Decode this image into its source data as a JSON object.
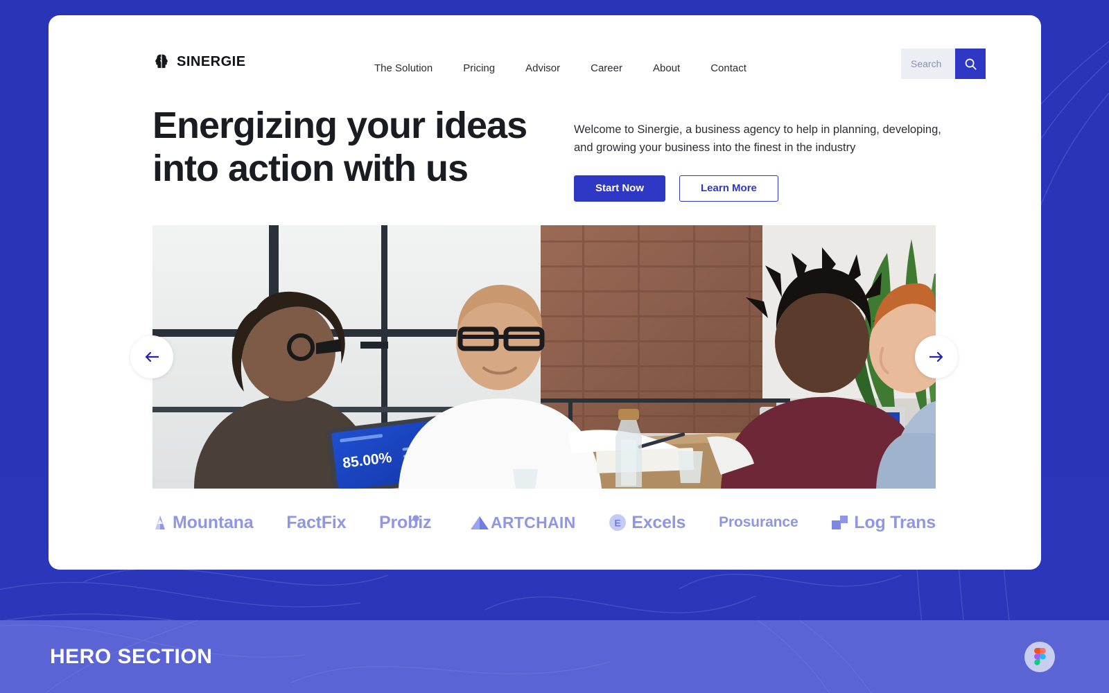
{
  "brand": {
    "name": "SINERGIE",
    "icon": "two-heads-icon",
    "color": "#111218"
  },
  "nav": {
    "items": [
      {
        "label": "The Solution"
      },
      {
        "label": "Pricing"
      },
      {
        "label": "Advisor"
      },
      {
        "label": "Career"
      },
      {
        "label": "About"
      },
      {
        "label": "Contact"
      }
    ]
  },
  "search": {
    "placeholder": "Search",
    "value": "",
    "icon": "search-icon",
    "button_color": "#2e38c4"
  },
  "hero": {
    "title": "Energizing your ideas into action with us",
    "description": "Welcome to Sinergie, a business agency to help in planning, developing, and growing your business into the finest in the industry",
    "primary_button": "Start Now",
    "secondary_button": "Learn More"
  },
  "carousel": {
    "prev_icon": "arrow-left-icon",
    "next_icon": "arrow-right-icon",
    "image_alt": "business meeting photo",
    "screen_value": "85.00%"
  },
  "partners": [
    {
      "name": "Mountana",
      "icon": "mountain-icon"
    },
    {
      "name": "FactFix",
      "icon": "none"
    },
    {
      "name": "Probiz",
      "icon": "dot-icon"
    },
    {
      "name": "ARTCHAIN",
      "icon": "triangle-icon"
    },
    {
      "name": "Excels",
      "icon": "circle-e-icon"
    },
    {
      "name": "Prosurance",
      "icon": "none"
    },
    {
      "name": "Log Trans",
      "icon": "two-squares-icon"
    }
  ],
  "footer": {
    "label": "HERO SECTION",
    "badge_icon": "figma-icon"
  },
  "colors": {
    "page_background": "#2a34b8",
    "card_background": "#ffffff",
    "accent": "#2e38c4",
    "partner_text": "#8d97e6",
    "bottom_bar": "#5a64d4"
  }
}
